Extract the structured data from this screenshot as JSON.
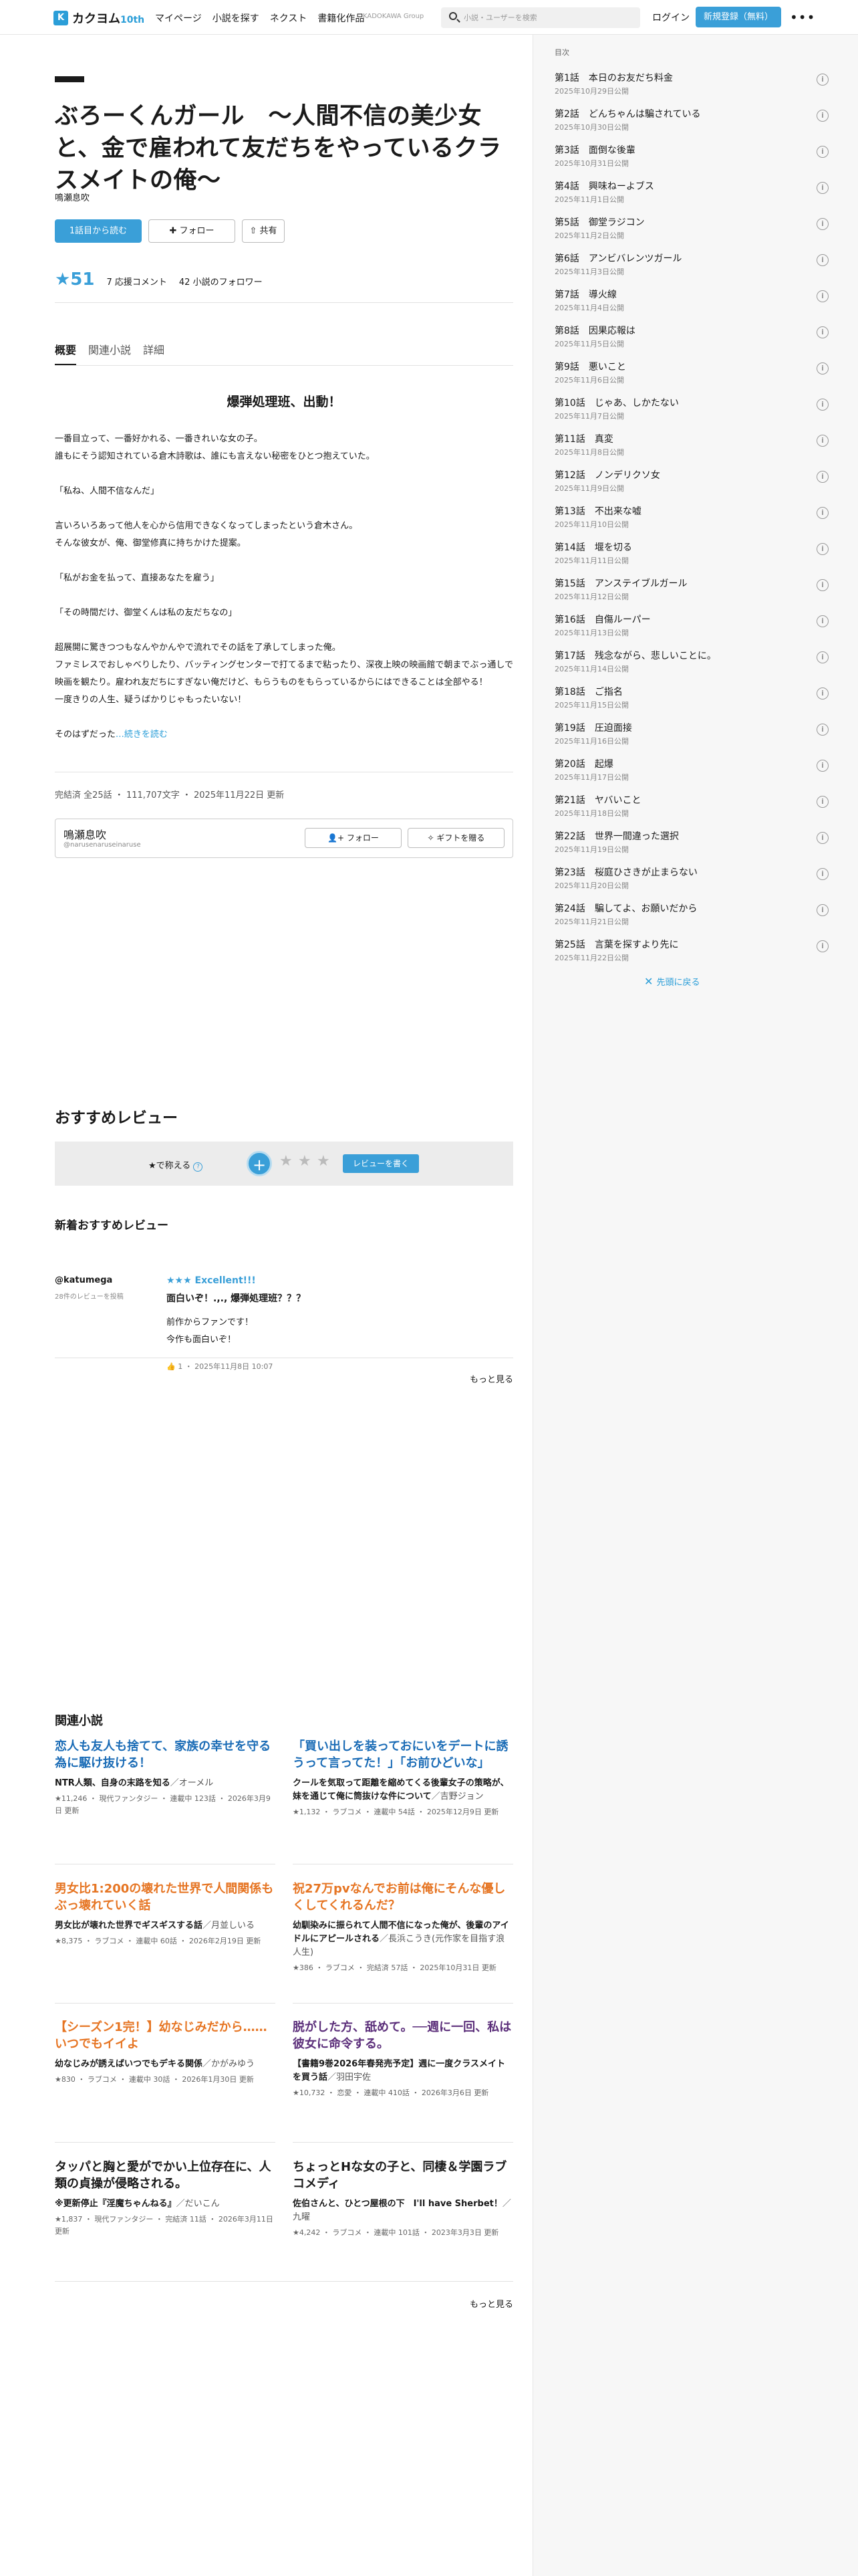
{
  "header": {
    "logo_mark": "K",
    "logo_text": "カクヨム",
    "logo_badge": "10th",
    "nav": [
      "マイページ",
      "小説を探す",
      "ネクスト",
      "書籍化作品"
    ],
    "group": "KADOKAWA Group",
    "search_placeholder": "小説・ユーザーを検索",
    "login": "ログイン",
    "signup": "新規登録（無料）",
    "more": "•••"
  },
  "work": {
    "title": "ぶろーくんガール　～人間不信の美少女と、金で雇われて友だちをやっているクラスメイトの俺～",
    "author": "鳴瀬息吹",
    "read_button": "1話目から読む",
    "follow_button": "フォロー",
    "share_button": "共有",
    "stars": "★51",
    "support_comments": "7 応援コメント",
    "followers": "42 小説のフォロワー",
    "tabs": [
      "概要",
      "関連小説",
      "詳細"
    ],
    "catchphrase": "爆弾処理班、出動！",
    "intro": [
      "一番目立って、一番好かれる、一番きれいな女の子。",
      "誰もにそう認知されている倉木詩歌は、誰にも言えない秘密をひとつ抱えていた。",
      "",
      "「私ね、人間不信なんだ」",
      "",
      "言いろいろあって他人を心から信用できなくなってしまったという倉木さん。",
      "そんな彼女が、俺、御堂修真に持ちかけた提案。",
      "",
      "「私がお金を払って、直接あなたを雇う」",
      "",
      "「その時間だけ、御堂くんは私の友だちなの」",
      "",
      "超展開に驚きつつもなんやかんやで流れでその話を了承してしまった俺。",
      "ファミレスでおしゃべりしたり、バッティングセンターで打てるまで粘ったり、深夜上映の映画館で朝までぶっ通しで映画を観たり。雇われ友だちにすぎない俺だけど、もらうものをもらっているからにはできることは全部やる！",
      "一度きりの人生、疑うばかりじゃもったいない！",
      "",
      "そのはずだった"
    ],
    "continue_link": "…続きを読む",
    "meta": "完結済 全25話 ・ 111,707文字 ・ 2025年11月22日 更新"
  },
  "author_card": {
    "name": "鳴瀬息吹",
    "handle": "@narusenaruseinaruse",
    "follow": "フォロー",
    "gift": "ギフトを贈る"
  },
  "reviews": {
    "heading": "おすすめレビュー",
    "rate_label": "★で称える",
    "rate_help": "?",
    "plus": "+",
    "empty_stars": [
      "★",
      "★",
      "★"
    ],
    "write_button": "レビューを書く",
    "new_heading": "新着おすすめレビュー",
    "user": "@katumega",
    "user_count": "28件のレビューを投稿",
    "rating": "★★★ Excellent!!!",
    "review_heading": "面白いぞ！.,., 爆弾処理班？？？",
    "review_text": "前作からファンです！\n今作も面白いぞ！",
    "review_meta": "👍 1 ・ 2025年11月8日 10:07",
    "more": "もっと見る"
  },
  "toc": {
    "title": "目次",
    "items": [
      {
        "t": "第1話　本日のお友だち料金",
        "d": "2025年10月29日公開"
      },
      {
        "t": "第2話　どんちゃんは騙されている",
        "d": "2025年10月30日公開"
      },
      {
        "t": "第3話　面倒な後輩",
        "d": "2025年10月31日公開"
      },
      {
        "t": "第4話　興味ねーよブス",
        "d": "2025年11月1日公開"
      },
      {
        "t": "第5話　御堂ラジコン",
        "d": "2025年11月2日公開"
      },
      {
        "t": "第6話　アンビバレンツガール",
        "d": "2025年11月3日公開"
      },
      {
        "t": "第7話　導火線",
        "d": "2025年11月4日公開"
      },
      {
        "t": "第8話　因果応報は",
        "d": "2025年11月5日公開"
      },
      {
        "t": "第9話　悪いこと",
        "d": "2025年11月6日公開"
      },
      {
        "t": "第10話　じゃあ、しかたない",
        "d": "2025年11月7日公開"
      },
      {
        "t": "第11話　真変",
        "d": "2025年11月8日公開"
      },
      {
        "t": "第12話　ノンデリクソ女",
        "d": "2025年11月9日公開"
      },
      {
        "t": "第13話　不出来な嘘",
        "d": "2025年11月10日公開"
      },
      {
        "t": "第14話　堰を切る",
        "d": "2025年11月11日公開"
      },
      {
        "t": "第15話　アンステイブルガール",
        "d": "2025年11月12日公開"
      },
      {
        "t": "第16話　自傷ルーパー",
        "d": "2025年11月13日公開"
      },
      {
        "t": "第17話　残念ながら、悲しいことに。",
        "d": "2025年11月14日公開"
      },
      {
        "t": "第18話　ご指名",
        "d": "2025年11月15日公開"
      },
      {
        "t": "第19話　圧迫面接",
        "d": "2025年11月16日公開"
      },
      {
        "t": "第20話　起爆",
        "d": "2025年11月17日公開"
      },
      {
        "t": "第21話　ヤバいこと",
        "d": "2025年11月18日公開"
      },
      {
        "t": "第22話　世界一間違った選択",
        "d": "2025年11月19日公開"
      },
      {
        "t": "第23話　桜庭ひさきが止まらない",
        "d": "2025年11月20日公開"
      },
      {
        "t": "第24話　騙してよ、お願いだから",
        "d": "2025年11月21日公開"
      },
      {
        "t": "第25話　言葉を探すより先に",
        "d": "2025年11月22日公開"
      }
    ],
    "first_link": "先頭に戻る"
  },
  "related": {
    "heading": "関連小説",
    "items": [
      {
        "title": "恋人も友人も捨てて、家族の幸せを守る為に駆け抜ける！",
        "color": "blue",
        "catch": "NTR人類、自身の末路を知る",
        "author": "／オーメル",
        "meta": "★11,246 ・ 現代ファンタジー ・ 連載中 123話 ・ 2026年3月9日 更新"
      },
      {
        "title": "「買い出しを装っておにいをデートに誘うって言ってた！」「お前ひどいな」",
        "color": "blue",
        "catch": "クールを気取って距離を縮めてくる後輩女子の策略が、妹を通じて俺に筒抜けな件について",
        "author": "／吉野ジョン",
        "meta": "★1,132 ・ ラブコメ ・ 連載中 54話 ・ 2025年12月9日 更新"
      },
      {
        "title": "男女比1:200の壊れた世界で人間関係もぶっ壊れていく話",
        "color": "orange",
        "catch": "男女比が壊れた世界でギスギスする話",
        "author": "／月並しいる",
        "meta": "★8,375 ・ ラブコメ ・ 連載中 60話 ・ 2026年2月19日 更新"
      },
      {
        "title": "祝27万pvなんでお前は俺にそんな優しくしてくれるんだ？",
        "color": "orange",
        "catch": "幼馴染みに振られて人間不信になった俺が、後輩のアイドルにアピールされる",
        "author": "／長浜こうき(元作家を目指す浪人生)",
        "meta": "★386 ・ ラブコメ ・ 完結済 57話 ・ 2025年10月31日 更新"
      },
      {
        "title": "【シーズン1完！】幼なじみだから……いつでもイイよ",
        "color": "orange",
        "catch": "幼なじみが誘えばいつでもデキる関係",
        "author": "／かがみゆう",
        "meta": "★830 ・ ラブコメ ・ 連載中 30話 ・ 2026年1月30日 更新"
      },
      {
        "title": "脱がした方、舐めて。──週に一回、私は彼女に命令する。",
        "color": "purple",
        "catch": "【書籍9巻2026年春発売予定】週に一度クラスメイトを買う話",
        "author": "／羽田宇佐",
        "meta": "★10,732 ・ 恋愛 ・ 連載中 410話 ・ 2026年3月6日 更新"
      },
      {
        "title": "タッパと胸と愛がでかい上位存在に、人類の貞操が侵略される。",
        "color": "black",
        "catch": "※更新停止『淫魔ちゃんねる』",
        "author": "／だいこん",
        "meta": "★1,837 ・ 現代ファンタジー ・ 完結済 11話 ・ 2026年3月11日 更新"
      },
      {
        "title": "ちょっとHな女の子と、同棲＆学園ラブコメディ",
        "color": "black",
        "catch": "佐伯さんと、ひとつ屋根の下　I'll have Sherbet！",
        "author": "／九曜",
        "meta": "★4,242 ・ ラブコメ ・ 連載中 101話 ・ 2023年3月3日 更新"
      }
    ],
    "more": "もっと見る"
  }
}
